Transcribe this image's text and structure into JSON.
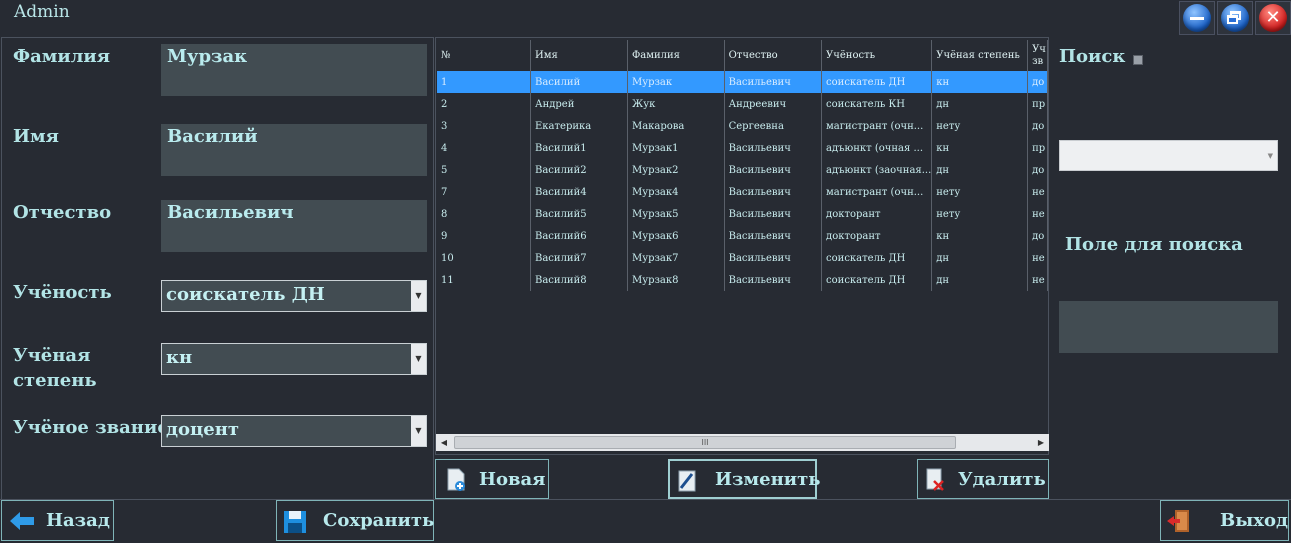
{
  "window": {
    "title": "Admin"
  },
  "form": {
    "surname_label": "Фамилия",
    "surname_value": "Мурзак",
    "name_label": "Имя",
    "name_value": "Василий",
    "patronymic_label": "Отчество",
    "patronymic_value": "Васильевич",
    "study_label": "Учёность",
    "study_value": "соискатель ДН",
    "degree_label": "Учёная степень",
    "degree_value": "кн",
    "title_label": "Учёное звание",
    "title_value": "доцент"
  },
  "grid": {
    "columns": [
      "№",
      "Имя",
      "Фамилия",
      "Отчество",
      "Учёность",
      "Учёная степень",
      "Уч зв"
    ],
    "rows": [
      [
        "1",
        "Василий",
        "Мурзак",
        "Васильевич",
        "соискатель ДН",
        "кн",
        "до"
      ],
      [
        "2",
        "Андрей",
        "Жук",
        "Андреевич",
        "соискатель КН",
        "дн",
        "пр"
      ],
      [
        "3",
        "Екатерика",
        "Макарова",
        "Сергеевна",
        "магистрант (очн...",
        "нету",
        "до"
      ],
      [
        "4",
        "Василий1",
        "Мурзак1",
        "Васильевич",
        "адъюнкт (очная ...",
        "кн",
        "пр"
      ],
      [
        "5",
        "Василий2",
        "Мурзак2",
        "Васильевич",
        "адъюнкт (заочная...",
        "дн",
        "до"
      ],
      [
        "7",
        "Василий4",
        "Мурзак4",
        "Васильевич",
        "магистрант (очн...",
        "нету",
        "не"
      ],
      [
        "8",
        "Василий5",
        "Мурзак5",
        "Васильевич",
        "докторант",
        "нету",
        "не"
      ],
      [
        "9",
        "Василий6",
        "Мурзак6",
        "Васильевич",
        "докторант",
        "кн",
        "до"
      ],
      [
        "10",
        "Василий7",
        "Мурзак7",
        "Васильевич",
        "соискатель ДН",
        "дн",
        "не"
      ],
      [
        "11",
        "Василий8",
        "Мурзак8",
        "Васильевич",
        "соискатель ДН",
        "дн",
        "не"
      ]
    ],
    "selected_row": 0
  },
  "actions": {
    "new_label": "Новая",
    "edit_label": "Изменить",
    "delete_label": "Удалить",
    "back_label": "Назад",
    "save_label": "Сохранить",
    "exit_label": "Выход"
  },
  "search": {
    "label": "Поиск",
    "checked": false,
    "combo_value": "",
    "field_label": "Поле для поиска",
    "field_value": ""
  },
  "colors": {
    "background": "#272b33",
    "text": "#a6dfe2",
    "input": "#424c52",
    "selection": "#3399ff"
  },
  "icons": [
    "minimize-icon",
    "restore-icon",
    "close-icon",
    "new-doc-icon",
    "edit-doc-icon",
    "delete-doc-icon",
    "back-arrow-icon",
    "floppy-icon",
    "exit-door-icon"
  ]
}
